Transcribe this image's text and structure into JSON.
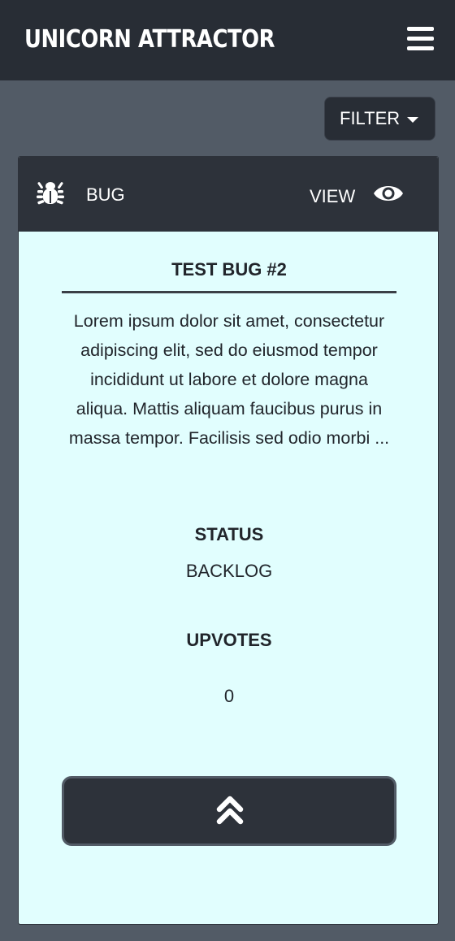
{
  "navbar": {
    "brand": "UNICORN ATTRACTOR",
    "menu_icon": "hamburger-menu-icon"
  },
  "toolbar": {
    "filter_label": "FILTER",
    "filter_icon": "caret-down-icon"
  },
  "card": {
    "type_icon": "bug-icon",
    "type_label": "BUG",
    "view_label": "VIEW",
    "view_icon": "eye-icon",
    "title": "TEST BUG #2",
    "description": "Lorem ipsum dolor sit amet, consectetur adipiscing elit, sed do eiusmod tempor incididunt ut labore et dolore magna aliqua. Mattis aliquam faucibus purus in massa tempor. Facilisis sed odio morbi ...",
    "status_heading": "STATUS",
    "status_value": "BACKLOG",
    "upvotes_heading": "UPVOTES",
    "upvotes_value": "0",
    "upvote_icon": "double-chevron-up-icon"
  },
  "colors": {
    "page_background": "#525b66",
    "navbar_background": "#282d35",
    "card_header_background": "#2d323a",
    "card_body_background": "#e1fefe",
    "text_dark": "#21252b",
    "text_light": "#ffffff"
  }
}
